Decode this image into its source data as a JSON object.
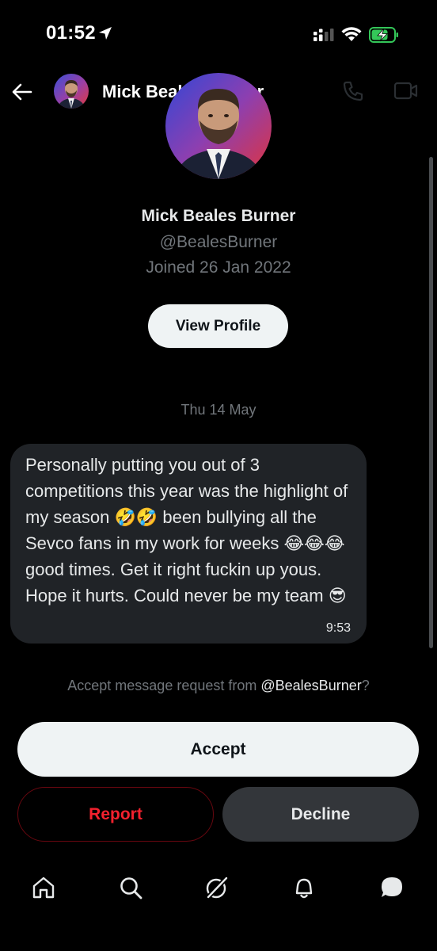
{
  "status_bar": {
    "time": "01:52"
  },
  "header": {
    "title": "Mick Beales Burner",
    "icons": [
      "back-arrow-icon",
      "phone-icon",
      "video-camera-icon"
    ]
  },
  "profile": {
    "name": "Mick Beales Burner",
    "handle": "@BealesBurner",
    "joined": "Joined 26 Jan 2022",
    "view_profile_label": "View Profile"
  },
  "conversation": {
    "date_label": "Thu 14 May",
    "messages": [
      {
        "text": "Personally putting you out of 3 competitions this year was the highlight of my season 🤣🤣 been bullying all the Sevco fans in my work for weeks 😂😂😂 good times. Get it right fuckin up yous. Hope it hurts. Could never be my team 😎",
        "time": "9:53"
      }
    ]
  },
  "request": {
    "prefix": "Accept message request from ",
    "handle": "@BealesBurner",
    "suffix": "?",
    "accept_label": "Accept",
    "report_label": "Report",
    "decline_label": "Decline"
  },
  "bottom_nav": {
    "items": [
      "home-icon",
      "search-icon",
      "grok-icon",
      "notifications-icon",
      "messages-icon"
    ],
    "active": "messages-icon"
  },
  "colors": {
    "background": "#000000",
    "bubble": "#202327",
    "secondary_text": "#71767b",
    "danger": "#f4212e",
    "battery_charging": "#34c759"
  }
}
